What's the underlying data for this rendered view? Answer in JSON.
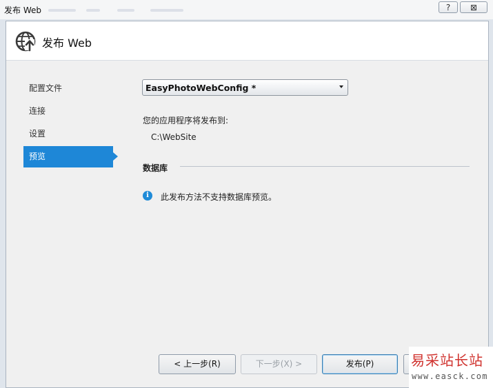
{
  "window": {
    "title": "发布 Web",
    "help_label": "?",
    "close_label": "⊠"
  },
  "header": {
    "title": "发布 Web",
    "icon": "globe-publish-icon"
  },
  "sidebar": {
    "items": [
      {
        "label": "配置文件",
        "active": false
      },
      {
        "label": "连接",
        "active": false
      },
      {
        "label": "设置",
        "active": false
      },
      {
        "label": "预览",
        "active": true
      }
    ]
  },
  "main": {
    "profile_select": {
      "value": "EasyPhotoWebConfig *"
    },
    "publish_to_label": "您的应用程序将发布到:",
    "publish_path": "C:\\WebSite",
    "database_section_title": "数据库",
    "database_info": "此发布方法不支持数据库预览。"
  },
  "footer": {
    "prev_label": "< 上一步(R)",
    "next_label": "下一步(X) >",
    "publish_label": "发布(P)"
  },
  "watermark": {
    "text": "易采站长站",
    "url": "www.easck.com"
  },
  "colors": {
    "accent": "#1e87d7",
    "info": "#1f8bd8",
    "watermark": "#d0322e"
  }
}
